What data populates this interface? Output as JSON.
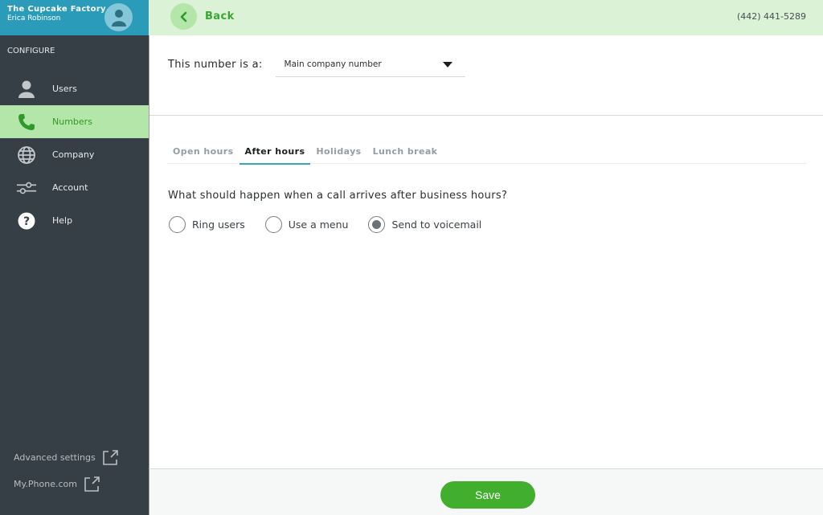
{
  "account": {
    "company": "The Cupcake Factory",
    "user": "Erica Robinson"
  },
  "sidebar": {
    "section_label": "CONFIGURE",
    "items": [
      {
        "label": "Users",
        "icon": "user-icon",
        "active": false
      },
      {
        "label": "Numbers",
        "icon": "phone-icon",
        "active": true
      },
      {
        "label": "Company",
        "icon": "globe-icon",
        "active": false
      },
      {
        "label": "Account",
        "icon": "sliders-icon",
        "active": false
      },
      {
        "label": "Help",
        "icon": "help-icon",
        "active": false
      }
    ],
    "external_links": [
      {
        "label": "Advanced settings",
        "icon": "external-link-icon"
      },
      {
        "label": "My.Phone.com",
        "icon": "external-link-icon"
      }
    ]
  },
  "topbar": {
    "back_label": "Back",
    "phone_number": "(442) 441-5289"
  },
  "number_type": {
    "label": "This number is a:",
    "selected": "Main company number"
  },
  "tabs": [
    {
      "label": "Open hours",
      "active": false
    },
    {
      "label": "After hours",
      "active": true
    },
    {
      "label": "Holidays",
      "active": false
    },
    {
      "label": "Lunch break",
      "active": false
    }
  ],
  "after_hours": {
    "question": "What should happen when a call arrives after business hours?",
    "options": [
      {
        "label": "Ring users",
        "selected": false
      },
      {
        "label": "Use a menu",
        "selected": false
      },
      {
        "label": "Send to voicemail",
        "selected": true
      }
    ]
  },
  "footer": {
    "save_label": "Save"
  },
  "colors": {
    "accent_green": "#42ae2e",
    "sidebar_bg": "#363f46",
    "header_blue": "#2a9bb8",
    "topbar_bg": "#dbf2d6",
    "tab_underline": "#3aa3c4"
  }
}
